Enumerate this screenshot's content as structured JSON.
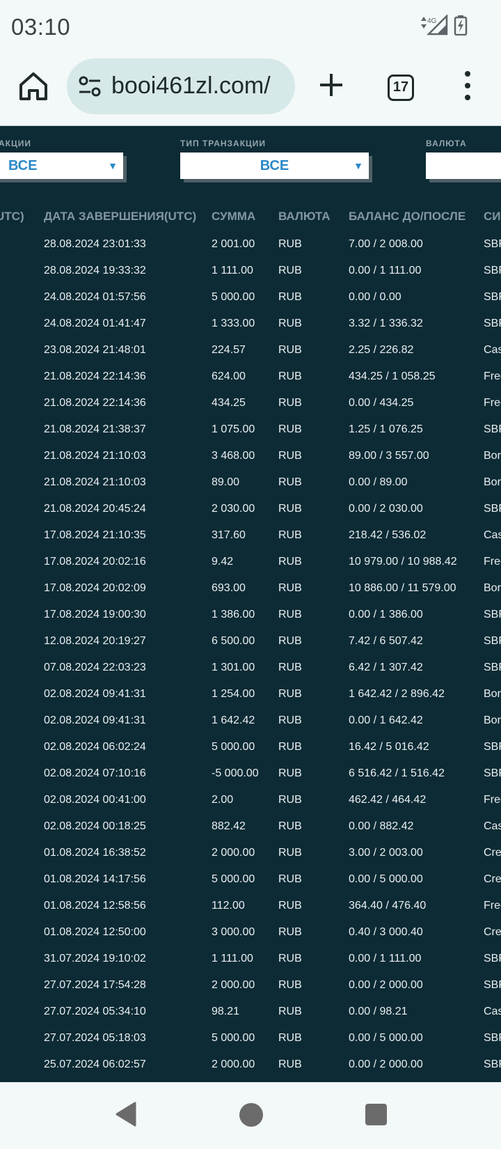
{
  "status": {
    "time": "03:10",
    "network": "4G"
  },
  "browser": {
    "url": "booi461zl.com/",
    "tab_count": "17",
    "icons": [
      "home-icon",
      "site-settings-icon",
      "plus-icon",
      "tabs-icon",
      "more-vert-icon"
    ]
  },
  "filters": {
    "type_label": "ТИП ТРАНЗАКЦИИ",
    "type_value": "ВСЕ",
    "partial_label": "АКЦИИ",
    "partial_value": "ВСЕ",
    "currency_label": "ВАЛЮТА"
  },
  "table": {
    "headers": {
      "start_partial": "UTC)",
      "completion_date": "ДАТА ЗАВЕРШЕНИЯ(UTC)",
      "amount": "СУММА",
      "currency": "ВАЛЮТА",
      "balance": "БАЛАНС ДО/ПОСЛЕ",
      "system_partial": "СИ"
    },
    "rows": [
      {
        "date": "28.08.2024 23:01:33",
        "amount": "2 001.00",
        "currency": "RUB",
        "balance": "7.00 / 2 008.00",
        "system": "SBF"
      },
      {
        "date": "28.08.2024 19:33:32",
        "amount": "1 111.00",
        "currency": "RUB",
        "balance": "0.00 / 1 111.00",
        "system": "SBF"
      },
      {
        "date": "24.08.2024 01:57:56",
        "amount": "5 000.00",
        "currency": "RUB",
        "balance": "0.00 / 0.00",
        "system": "SBF"
      },
      {
        "date": "24.08.2024 01:41:47",
        "amount": "1 333.00",
        "currency": "RUB",
        "balance": "3.32 / 1 336.32",
        "system": "SBF"
      },
      {
        "date": "23.08.2024 21:48:01",
        "amount": "224.57",
        "currency": "RUB",
        "balance": "2.25 / 226.82",
        "system": "Cas"
      },
      {
        "date": "21.08.2024 22:14:36",
        "amount": "624.00",
        "currency": "RUB",
        "balance": "434.25 / 1 058.25",
        "system": "Free"
      },
      {
        "date": "21.08.2024 22:14:36",
        "amount": "434.25",
        "currency": "RUB",
        "balance": "0.00 / 434.25",
        "system": "Free"
      },
      {
        "date": "21.08.2024 21:38:37",
        "amount": "1 075.00",
        "currency": "RUB",
        "balance": "1.25 / 1 076.25",
        "system": "SBF"
      },
      {
        "date": "21.08.2024 21:10:03",
        "amount": "3 468.00",
        "currency": "RUB",
        "balance": "89.00 / 3 557.00",
        "system": "Bor"
      },
      {
        "date": "21.08.2024 21:10:03",
        "amount": "89.00",
        "currency": "RUB",
        "balance": "0.00 / 89.00",
        "system": "Bor"
      },
      {
        "date": "21.08.2024 20:45:24",
        "amount": "2 030.00",
        "currency": "RUB",
        "balance": "0.00 / 2 030.00",
        "system": "SBF"
      },
      {
        "date": "17.08.2024 21:10:35",
        "amount": "317.60",
        "currency": "RUB",
        "balance": "218.42 / 536.02",
        "system": "Cas"
      },
      {
        "date": "17.08.2024 20:02:16",
        "amount": "9.42",
        "currency": "RUB",
        "balance": "10 979.00 / 10 988.42",
        "system": "Free"
      },
      {
        "date": "17.08.2024 20:02:09",
        "amount": "693.00",
        "currency": "RUB",
        "balance": "10 886.00 / 11 579.00",
        "system": "Bor"
      },
      {
        "date": "17.08.2024 19:00:30",
        "amount": "1 386.00",
        "currency": "RUB",
        "balance": "0.00 / 1 386.00",
        "system": "SBF"
      },
      {
        "date": "12.08.2024 20:19:27",
        "amount": "6 500.00",
        "currency": "RUB",
        "balance": "7.42 / 6 507.42",
        "system": "SBF"
      },
      {
        "date": "07.08.2024 22:03:23",
        "amount": "1 301.00",
        "currency": "RUB",
        "balance": "6.42 / 1 307.42",
        "system": "SBF"
      },
      {
        "date": "02.08.2024 09:41:31",
        "amount": "1 254.00",
        "currency": "RUB",
        "balance": "1 642.42 / 2 896.42",
        "system": "Bor"
      },
      {
        "date": "02.08.2024 09:41:31",
        "amount": "1 642.42",
        "currency": "RUB",
        "balance": "0.00 / 1 642.42",
        "system": "Bor"
      },
      {
        "date": "02.08.2024 06:02:24",
        "amount": "5 000.00",
        "currency": "RUB",
        "balance": "16.42 / 5 016.42",
        "system": "SBF"
      },
      {
        "date": "02.08.2024 07:10:16",
        "amount": "-5 000.00",
        "currency": "RUB",
        "balance": "6 516.42 / 1 516.42",
        "system": "SBF"
      },
      {
        "date": "02.08.2024 00:41:00",
        "amount": "2.00",
        "currency": "RUB",
        "balance": "462.42 / 464.42",
        "system": "Free"
      },
      {
        "date": "02.08.2024 00:18:25",
        "amount": "882.42",
        "currency": "RUB",
        "balance": "0.00 / 882.42",
        "system": "Cas"
      },
      {
        "date": "01.08.2024 16:38:52",
        "amount": "2 000.00",
        "currency": "RUB",
        "balance": "3.00 / 2 003.00",
        "system": "Cre"
      },
      {
        "date": "01.08.2024 14:17:56",
        "amount": "5 000.00",
        "currency": "RUB",
        "balance": "0.00 / 5 000.00",
        "system": "Cre"
      },
      {
        "date": "01.08.2024 12:58:56",
        "amount": "112.00",
        "currency": "RUB",
        "balance": "364.40 / 476.40",
        "system": "Free"
      },
      {
        "date": "01.08.2024 12:50:00",
        "amount": "3 000.00",
        "currency": "RUB",
        "balance": "0.40 / 3 000.40",
        "system": "Cre"
      },
      {
        "date": "31.07.2024 19:10:02",
        "amount": "1 111.00",
        "currency": "RUB",
        "balance": "0.00 / 1 111.00",
        "system": "SBF"
      },
      {
        "date": "27.07.2024 17:54:28",
        "amount": "2 000.00",
        "currency": "RUB",
        "balance": "0.00 / 2 000.00",
        "system": "SBF"
      },
      {
        "date": "27.07.2024 05:34:10",
        "amount": "98.21",
        "currency": "RUB",
        "balance": "0.00 / 98.21",
        "system": "Cas"
      },
      {
        "date": "27.07.2024 05:18:03",
        "amount": "5 000.00",
        "currency": "RUB",
        "balance": "0.00 / 5 000.00",
        "system": "SBF"
      },
      {
        "date": "25.07.2024 06:02:57",
        "amount": "2 000.00",
        "currency": "RUB",
        "balance": "0.00 / 2 000.00",
        "system": "SBF"
      }
    ]
  },
  "colors": {
    "page_bg": "#0d2b35",
    "select_accent": "#2a88c8",
    "header_text": "#8397a0",
    "chrome_bg": "#f3f8f8",
    "urlbar_bg": "#d6e8e8"
  }
}
